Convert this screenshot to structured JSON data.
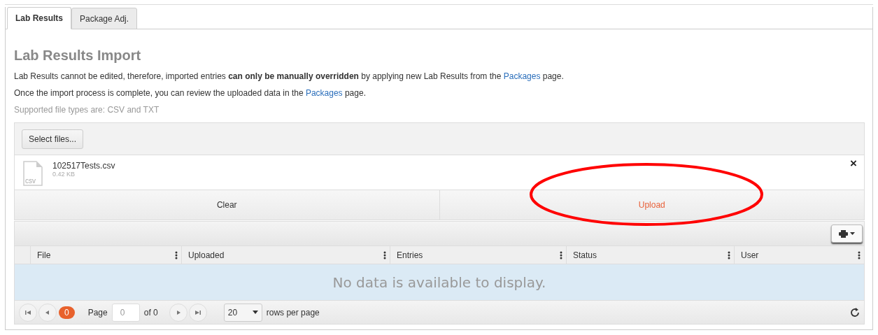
{
  "tabs": [
    {
      "label": "Lab Results",
      "selected": true
    },
    {
      "label": "Package Adj.",
      "selected": false
    }
  ],
  "heading": "Lab Results Import",
  "paragraphs": [
    [
      {
        "kind": "text",
        "text": "Lab Results cannot be edited, therefore, imported entries **can only be manually overridden** by applying new Lab Results from the "
      },
      {
        "kind": "link",
        "text": "Packages"
      },
      {
        "kind": "text",
        "text": " page."
      }
    ],
    [
      {
        "kind": "text",
        "text": "Once the import process is complete, you can review the uploaded data in the "
      },
      {
        "kind": "link",
        "text": "Packages"
      },
      {
        "kind": "text",
        "text": " page."
      }
    ]
  ],
  "note": "Supported file types are: CSV and TXT",
  "upload": {
    "select_button": "Select files...",
    "file": {
      "ext": "csv",
      "name": "102517Tests.csv",
      "size": "0.42 KB",
      "remove": "×"
    },
    "clear_button": "Clear",
    "upload_button": "Upload",
    "highlighted": true
  },
  "grid": {
    "columns": [
      "File",
      "Uploaded",
      "Entries",
      "Status",
      "User"
    ],
    "empty_message": "No data is available to display.",
    "pager": {
      "count": "0",
      "page_label": "Page",
      "page_value": "0",
      "of": "of 0",
      "page_size": "20",
      "rows_label": "rows per page"
    }
  }
}
